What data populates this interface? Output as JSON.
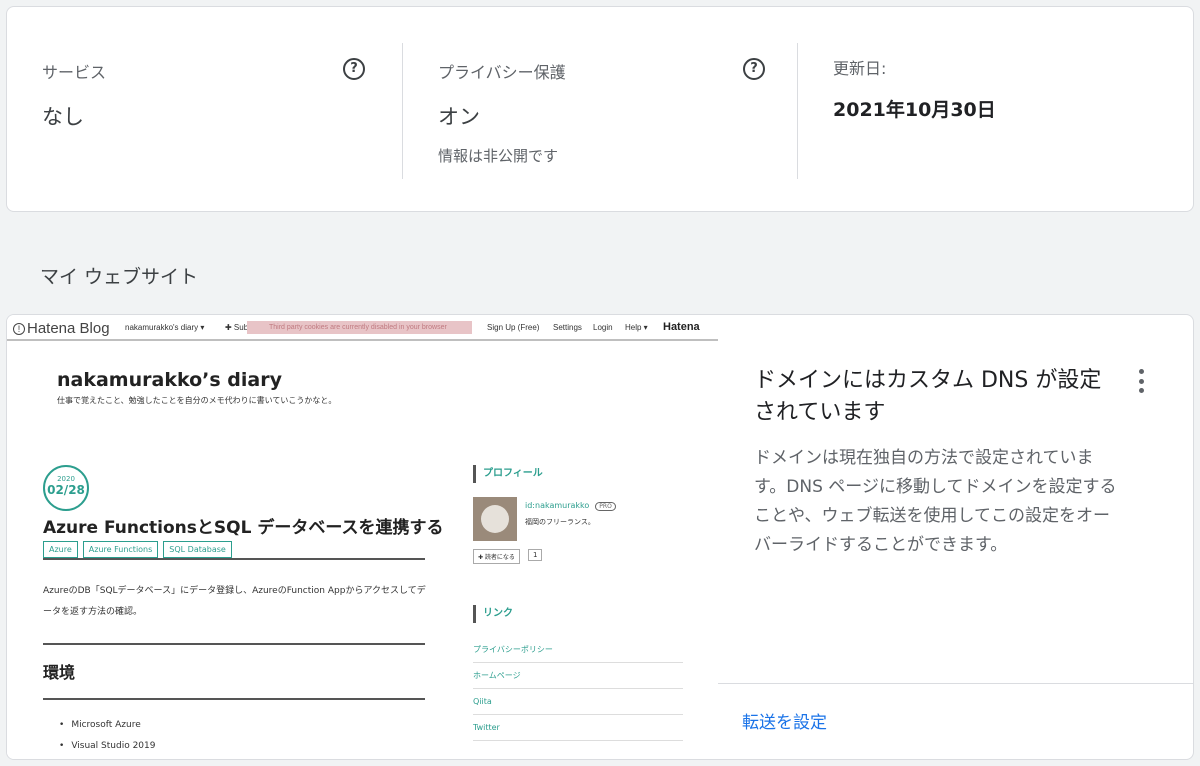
{
  "info": {
    "service": {
      "label": "サービス",
      "value": "なし"
    },
    "privacy": {
      "label": "プライバシー保護",
      "value": "オン",
      "sub": "情報は非公開です"
    },
    "updated": {
      "label": "更新日:",
      "value": "2021年10月30日"
    },
    "help_glyph": "?"
  },
  "section_title": "マイ ウェブサイト",
  "preview": {
    "topbar": {
      "brand": "Hatena Blog",
      "blog_menu": "nakamurakko's diary ▾",
      "subscribe": "✚ Sub",
      "cookie_notice": "Third party cookies are currently disabled in your browser",
      "signup": "Sign Up (Free)",
      "settings": "Settings",
      "login": "Login",
      "help": "Help ▾",
      "hatena": "Hatena"
    },
    "blog_title": "nakamurakko’s diary",
    "blog_tagline": "仕事で覚えたこと、勉強したことを自分のメモ代わりに書いていこうかなと。",
    "date_year": "2020",
    "date_day": "02/28",
    "article_title": "Azure FunctionsとSQL データベースを連携する",
    "tags": [
      "Azure",
      "Azure Functions",
      "SQL Database"
    ],
    "body": "AzureのDB「SQLデータベース」にデータ登録し、AzureのFunction Appからアクセスしてデータを返す方法の確認。",
    "env_heading": "環境",
    "bullets": [
      "Microsoft Azure",
      "Visual Studio 2019"
    ],
    "profile_heading": "プロフィール",
    "profile_id": "id:nakamurakko",
    "pro_badge": "PRO",
    "profile_desc": "福岡のフリーランス。",
    "reader_button": "✚ 読者になる",
    "reader_count": "1",
    "links_heading": "リンク",
    "links": [
      "プライバシーポリシー",
      "ホームページ",
      "Qiita",
      "Twitter"
    ]
  },
  "dns": {
    "title": "ドメインにはカスタム DNS が設定されています",
    "description": "ドメインは現在独自の方法で設定されています。DNS ページに移動してドメインを設定することや、ウェブ転送を使用してこの設定をオーバーライドすることができます。",
    "forward_link": "転送を設定"
  },
  "colors": {
    "accent": "#1a73e8",
    "blog_accent": "#2c9e8e",
    "border": "#dadce0"
  }
}
